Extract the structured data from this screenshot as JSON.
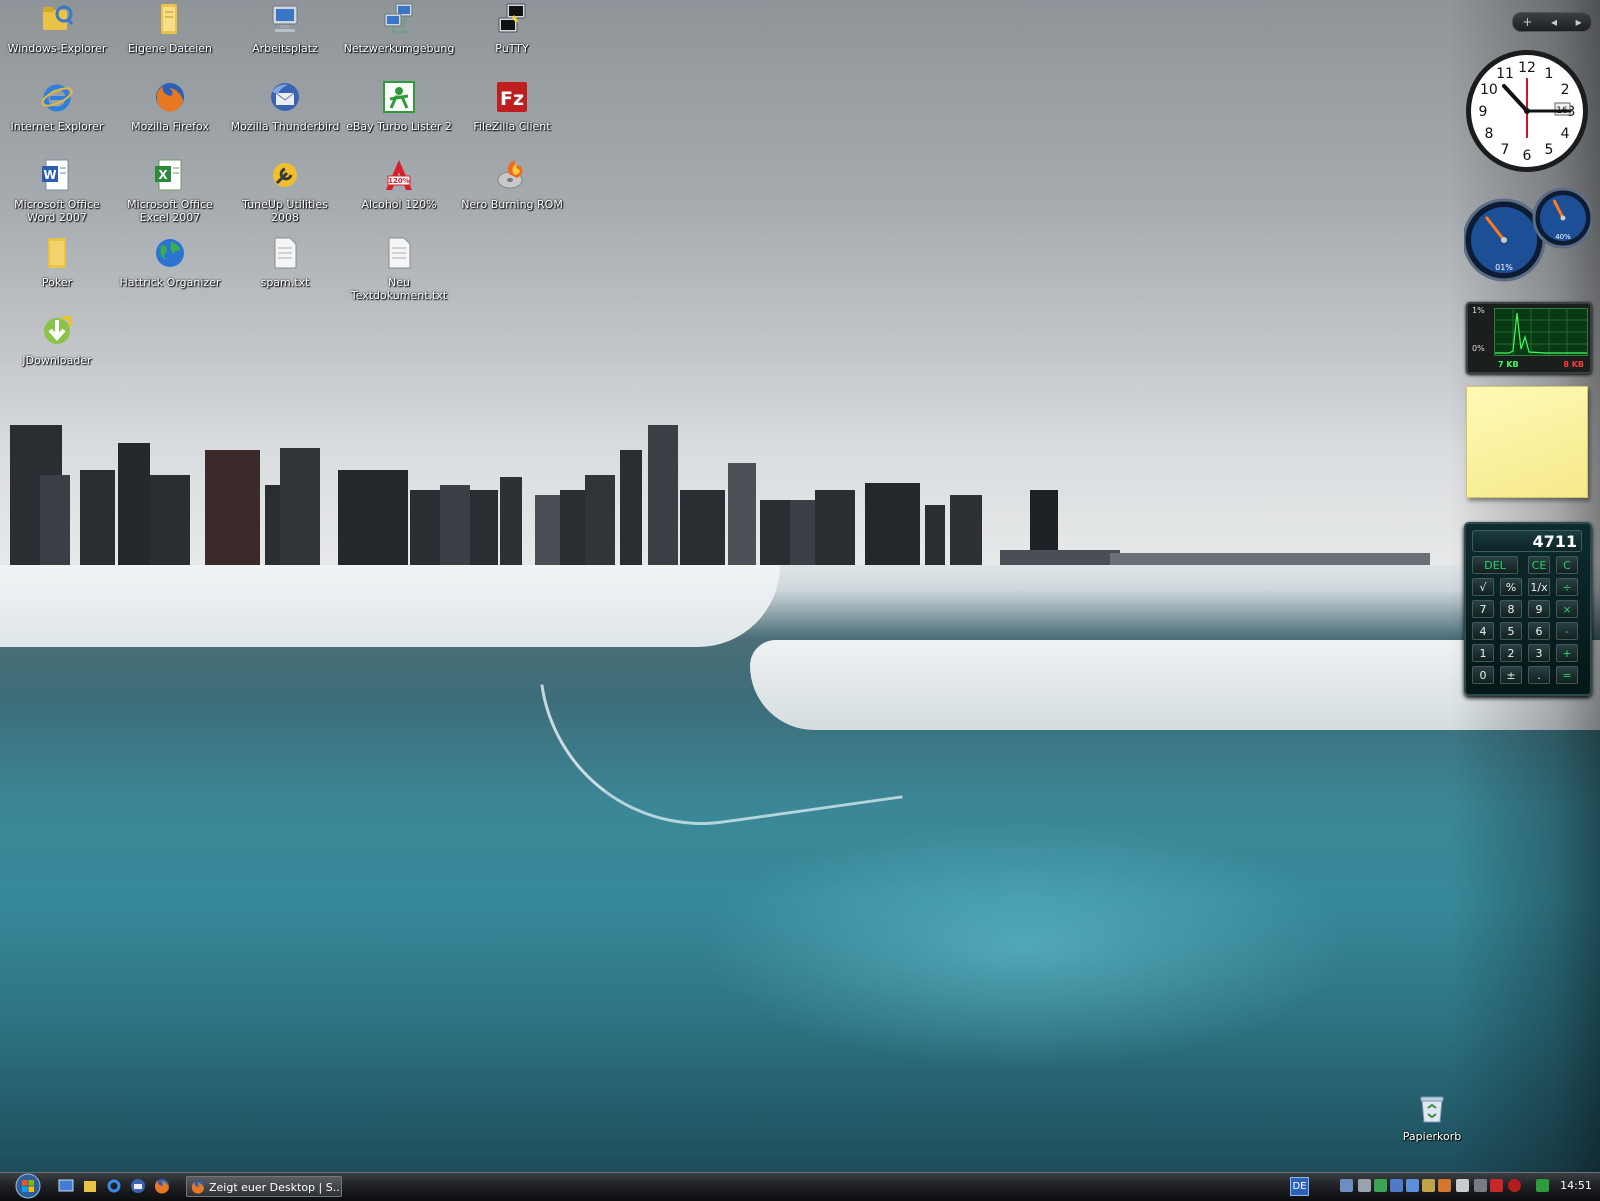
{
  "desktop": {
    "icons": [
      {
        "label": "Windows-Explorer",
        "icon": "explorer-folder-icon"
      },
      {
        "label": "Eigene Dateien",
        "icon": "documents-folder-icon"
      },
      {
        "label": "Arbeitsplatz",
        "icon": "computer-icon"
      },
      {
        "label": "Netzwerkumgebung",
        "icon": "network-icon"
      },
      {
        "label": "PuTTY",
        "icon": "putty-icon"
      },
      {
        "label": "Internet Explorer",
        "icon": "internet-explorer-icon"
      },
      {
        "label": "Mozilla Firefox",
        "icon": "firefox-icon"
      },
      {
        "label": "Mozilla Thunderbird",
        "icon": "thunderbird-icon"
      },
      {
        "label": "eBay Turbo Lister 2",
        "icon": "turbo-lister-icon"
      },
      {
        "label": "FileZilla Client",
        "icon": "filezilla-icon"
      },
      {
        "label": "Microsoft Office Word 2007",
        "icon": "word-icon"
      },
      {
        "label": "Microsoft Office Excel 2007",
        "icon": "excel-icon"
      },
      {
        "label": "TuneUp Utilities 2008",
        "icon": "tuneup-icon"
      },
      {
        "label": "Alcohol 120%",
        "icon": "alcohol-icon"
      },
      {
        "label": "Nero Burning ROM",
        "icon": "nero-icon"
      },
      {
        "label": "Poker",
        "icon": "folder-icon"
      },
      {
        "label": "Hattrick Organizer",
        "icon": "globe-icon"
      },
      {
        "label": "spam.txt",
        "icon": "text-file-icon"
      },
      {
        "label": "Neu Textdokument.txt",
        "icon": "text-file-icon"
      },
      {
        "label": "JDownloader",
        "icon": "jdownloader-icon"
      }
    ],
    "recycle_bin": {
      "label": "Papierkorb",
      "icon": "recycle-bin-icon"
    }
  },
  "sidebar": {
    "controls": {
      "add": "+",
      "prev": "◂",
      "next": "▸"
    },
    "clock": {
      "numbers": [
        "12",
        "1",
        "2",
        "3",
        "4",
        "5",
        "6",
        "7",
        "8",
        "9",
        "10",
        "11"
      ],
      "date": "16"
    },
    "meter": {
      "cpu": "01%",
      "memory": "40%",
      "cpu_level": 0.01,
      "memory_level": 0.4
    },
    "network": {
      "top_pct": "1%",
      "bottom_pct": "0%",
      "received": "7 KB",
      "sent": "8 KB"
    },
    "calculator": {
      "display": "4711",
      "keys": [
        [
          "DEL",
          "CE",
          "C"
        ],
        [
          "√",
          "%",
          "1/x",
          "÷"
        ],
        [
          "7",
          "8",
          "9",
          "×"
        ],
        [
          "4",
          "5",
          "6",
          "-"
        ],
        [
          "1",
          "2",
          "3",
          "+"
        ],
        [
          "0",
          "±",
          ".",
          "="
        ]
      ]
    }
  },
  "taskbar": {
    "quick_launch": [
      "show-desktop-icon",
      "explorer-icon",
      "internet-explorer-icon",
      "thunderbird-icon",
      "firefox-icon"
    ],
    "window_button": "Zeigt euer Desktop | S...",
    "language": "DE",
    "time": "14:51"
  }
}
